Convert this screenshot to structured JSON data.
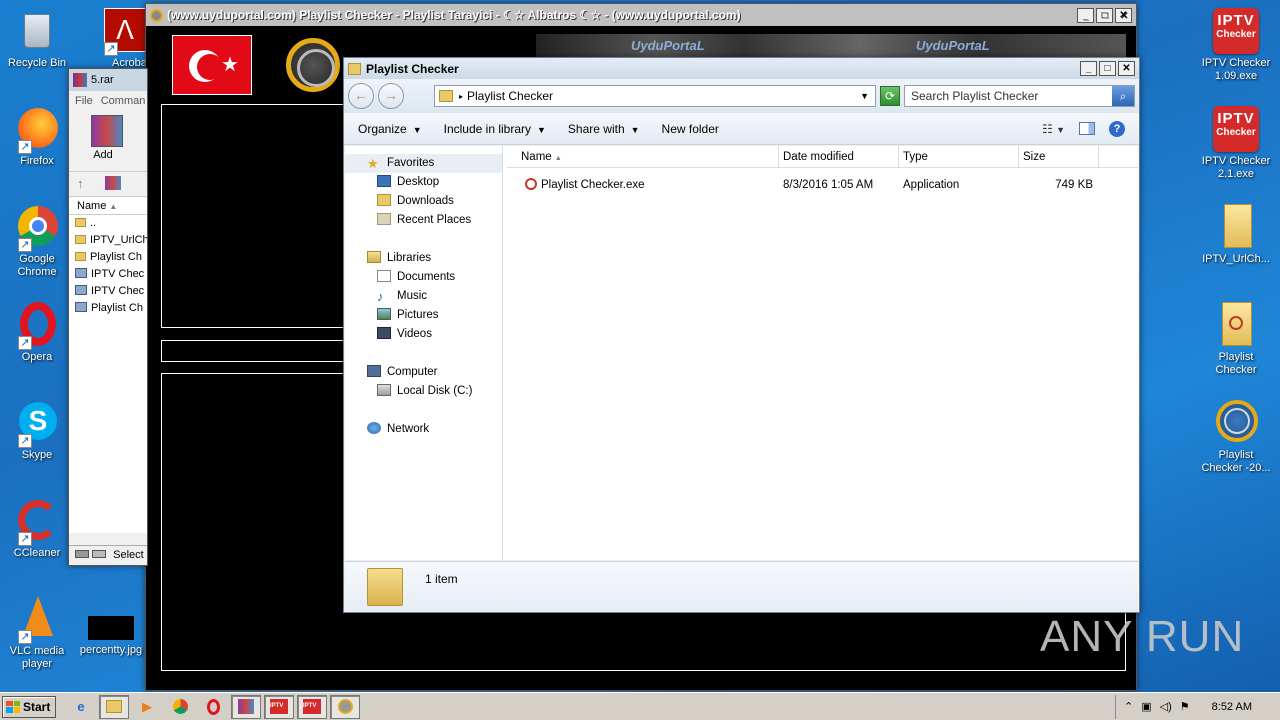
{
  "desktop": {
    "left_icons": [
      {
        "label": "Recycle Bin",
        "icon": "recycle-bin-icon"
      },
      {
        "label": "Firefox",
        "icon": "firefox-icon"
      },
      {
        "label": "Google Chrome",
        "icon": "chrome-icon"
      },
      {
        "label": "Opera",
        "icon": "opera-icon"
      },
      {
        "label": "Skype",
        "icon": "skype-icon"
      },
      {
        "label": "CCleaner",
        "icon": "ccleaner-icon"
      },
      {
        "label": "VLC media player",
        "icon": "vlc-icon"
      }
    ],
    "acrobat_label": "Acrobat",
    "percent_label": "percentty.jpg",
    "right_icons": [
      {
        "label": "IPTV Checker 1.09.exe",
        "icon": "iptv-checker-icon"
      },
      {
        "label": "IPTV Checker 2.1.exe",
        "icon": "iptv-checker-icon"
      },
      {
        "label": "IPTV_UrlCh...",
        "icon": "file-icon"
      },
      {
        "label": "Playlist Checker",
        "icon": "playlist-checker-icon"
      },
      {
        "label": "Playlist Checker -20...",
        "icon": "globe-icon"
      }
    ],
    "iptv_badge_top": "IPTV",
    "iptv_badge_bottom": "Checker"
  },
  "player_window": {
    "title": "(www.uyduportal.com) Playlist Checker - Playlist Tarayici - ☾☆ Albatros ☾☆ - (www.uyduportal.com)",
    "banner_text_1": "UyduPortaL",
    "banner_text_2": "UyduPortaL"
  },
  "rar_window": {
    "title": "5.rar",
    "menu": [
      "File",
      "Comman"
    ],
    "add_label": "Add",
    "col_name": "Name",
    "rows": [
      "..",
      "IPTV_UrlCh",
      "Playlist Ch",
      "IPTV Chec",
      "IPTV Chec",
      "Playlist Ch"
    ],
    "status": "Select"
  },
  "explorer": {
    "title": "Playlist Checker",
    "address": "Playlist Checker",
    "search_placeholder": "Search Playlist Checker",
    "toolbar": {
      "organize": "Organize",
      "include": "Include in library",
      "share": "Share with",
      "new_folder": "New folder"
    },
    "nav": {
      "favorites": "Favorites",
      "favorite_items": [
        "Desktop",
        "Downloads",
        "Recent Places"
      ],
      "libraries": "Libraries",
      "library_items": [
        "Documents",
        "Music",
        "Pictures",
        "Videos"
      ],
      "computer": "Computer",
      "computer_items": [
        "Local Disk (C:)"
      ],
      "network": "Network"
    },
    "columns": {
      "name": "Name",
      "date": "Date modified",
      "type": "Type",
      "size": "Size"
    },
    "files": [
      {
        "name": "Playlist Checker.exe",
        "date": "8/3/2016 1:05 AM",
        "type": "Application",
        "size": "749 KB"
      }
    ],
    "status": "1 item"
  },
  "taskbar": {
    "start": "Start",
    "clock": "8:52 AM"
  },
  "watermark": "ANY RUN"
}
